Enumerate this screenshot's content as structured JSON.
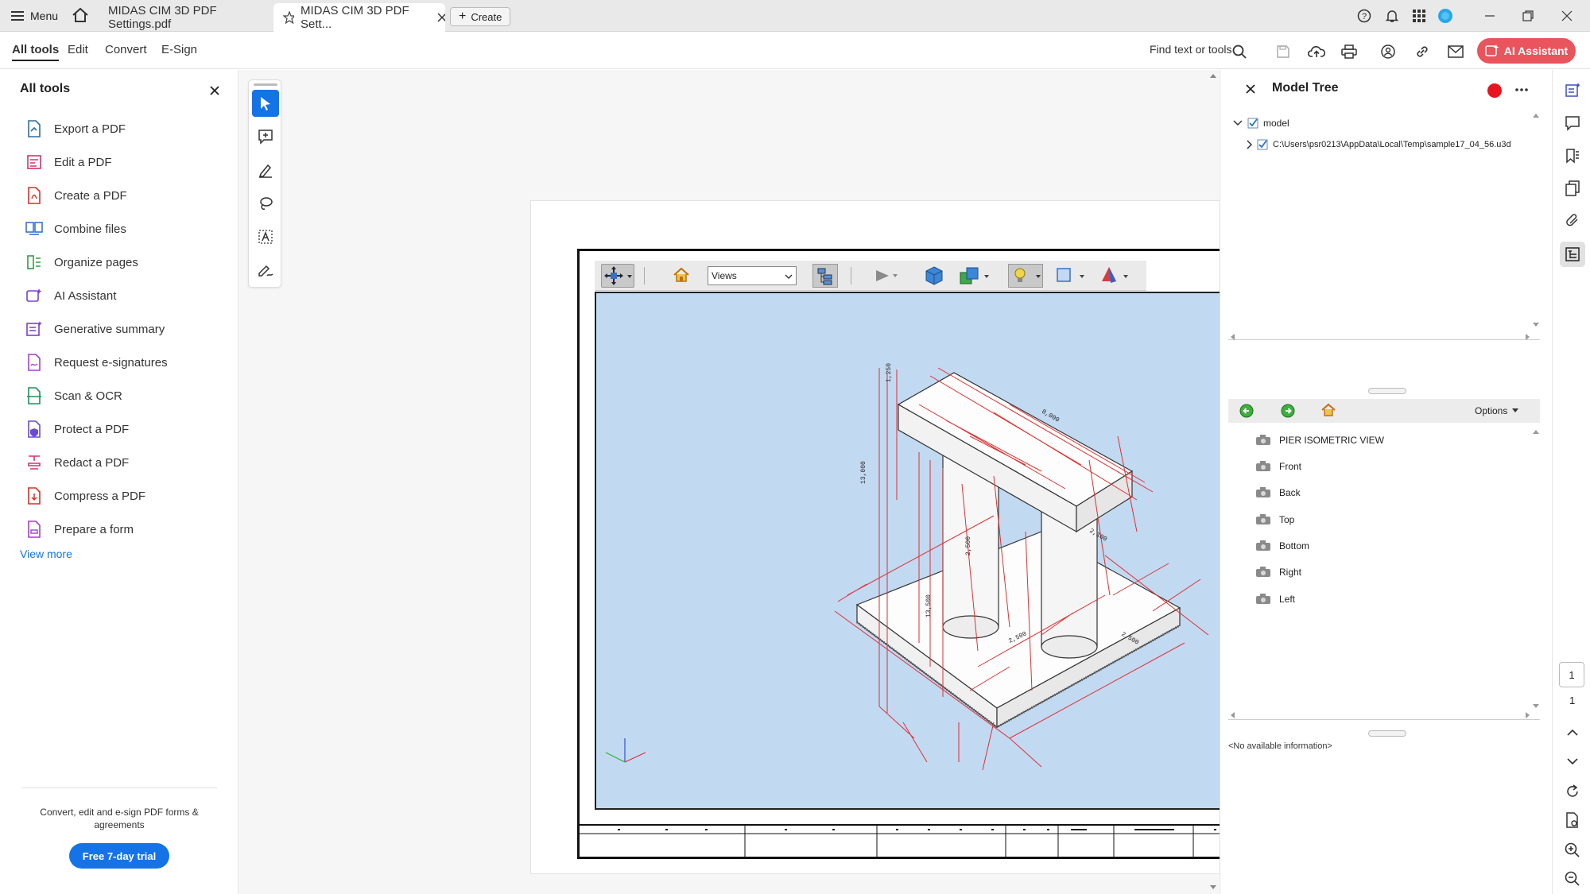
{
  "titlebar": {
    "menu_label": "Menu",
    "tabs": [
      {
        "label": "MIDAS CIM 3D PDF Settings.pdf"
      },
      {
        "label": "MIDAS CIM 3D PDF Sett..."
      }
    ],
    "create_label": "Create"
  },
  "menubar": {
    "items": [
      "All tools",
      "Edit",
      "Convert",
      "E-Sign"
    ],
    "find_label": "Find text or tools",
    "ai_assistant_label": "AI Assistant"
  },
  "left_panel": {
    "title": "All tools",
    "tools": [
      {
        "label": "Export a PDF",
        "color": "#2f6d9e"
      },
      {
        "label": "Edit a PDF",
        "color": "#d6336c"
      },
      {
        "label": "Create a PDF",
        "color": "#d93025"
      },
      {
        "label": "Combine files",
        "color": "#3b6fd4"
      },
      {
        "label": "Organize pages",
        "color": "#2e9e44"
      },
      {
        "label": "AI Assistant",
        "color": "#7b3fd0"
      },
      {
        "label": "Generative summary",
        "color": "#7b3fd0"
      },
      {
        "label": "Request e-signatures",
        "color": "#a43fd0"
      },
      {
        "label": "Scan & OCR",
        "color": "#1e8f5a"
      },
      {
        "label": "Protect a PDF",
        "color": "#6a4bd6"
      },
      {
        "label": "Redact a PDF",
        "color": "#d6336c"
      },
      {
        "label": "Compress a PDF",
        "color": "#d93025"
      },
      {
        "label": "Prepare a form",
        "color": "#a43fd0"
      }
    ],
    "view_more": "View more",
    "promo_text": "Convert, edit and e-sign PDF forms & agreements",
    "trial_button": "Free 7-day trial"
  },
  "viewer3d": {
    "views_select": "Views"
  },
  "model_tree": {
    "title": "Model Tree",
    "root": "model",
    "child": "C:\\Users\\psr0213\\AppData\\Local\\Temp\\sample17_04_56.u3d",
    "options_label": "Options",
    "views": [
      "PIER ISOMETRIC VIEW",
      "Front",
      "Back",
      "Top",
      "Bottom",
      "Right",
      "Left"
    ],
    "info": "<No available information>"
  },
  "page_nav": {
    "current": "1",
    "total": "1"
  },
  "colors": {
    "accent_blue": "#1473e6",
    "ai_button": "#e9545d",
    "viewport_bg": "#c2d9f2",
    "red_dimension": "#e03030",
    "record_dot": "#e8141e"
  }
}
